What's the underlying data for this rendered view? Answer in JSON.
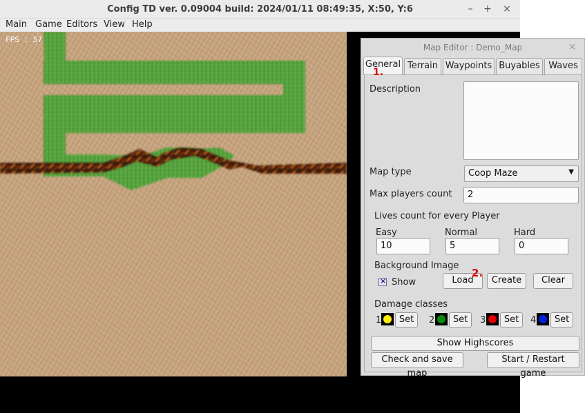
{
  "window": {
    "title": "Config TD ver. 0.09004 build: 2024/01/11  08:49:35, X:50, Y:6",
    "minimize": "–",
    "maximize": "+",
    "close": "×"
  },
  "menu": [
    "Main",
    "Game",
    "Editors",
    "View",
    "Help"
  ],
  "game": {
    "fps_label": "FPS : 57"
  },
  "editor": {
    "title": "Map Editor : Demo_Map",
    "close": "×",
    "tabs": [
      "General",
      "Terrain",
      "Waypoints",
      "Buyables",
      "Waves"
    ],
    "active_tab": "General",
    "description_label": "Description",
    "description_value": "",
    "map_type_label": "Map type",
    "map_type_value": "Coop Maze",
    "max_players_label": "Max players count",
    "max_players_value": "2",
    "lives_label": "Lives count for every Player",
    "lives": {
      "easy_label": "Easy",
      "easy_value": "10",
      "normal_label": "Normal",
      "normal_value": "5",
      "hard_label": "Hard",
      "hard_value": "0"
    },
    "background_label": "Background Image",
    "show_label": "Show",
    "show_checked": true,
    "load_button": "Load",
    "create_button": "Create",
    "clear_button": "Clear",
    "damage_label": "Damage classes",
    "damage_classes": [
      {
        "num": "1",
        "color": "#ffee00",
        "set": "Set"
      },
      {
        "num": "2",
        "color": "#0a8a0a",
        "set": "Set"
      },
      {
        "num": "3",
        "color": "#e00000",
        "set": "Set"
      },
      {
        "num": "4",
        "color": "#0022dd",
        "set": "Set"
      }
    ],
    "highscores_button": "Show Highscores",
    "check_save_button": "Check and save map",
    "start_button": "Start / Restart game"
  },
  "annotations": [
    "1.",
    "2."
  ],
  "colors": {
    "sand": "#c8a57e",
    "grass": "#4f9b3a",
    "lava": "#7a3510",
    "annotation": "#e00000"
  }
}
